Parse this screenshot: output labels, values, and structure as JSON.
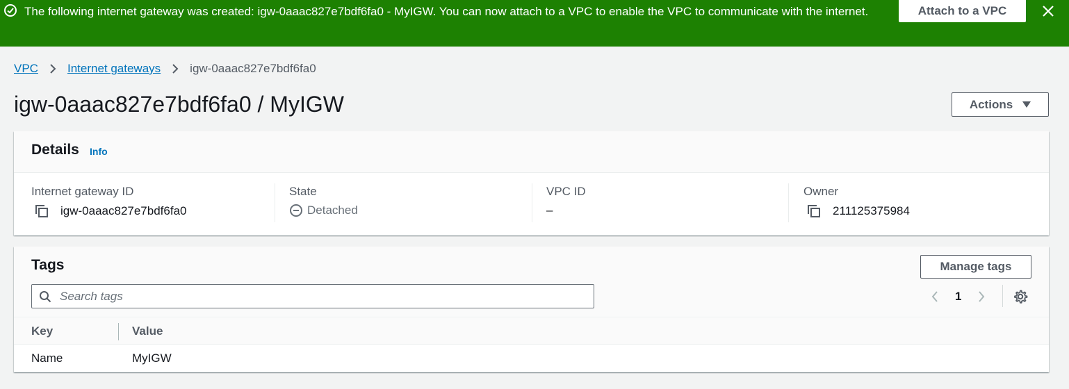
{
  "flash": {
    "message": "The following internet gateway was created: igw-0aaac827e7bdf6fa0 - MyIGW. You can now attach to a VPC to enable the VPC to communicate with the internet.",
    "action_label": "Attach to a VPC",
    "color": "#1d8102"
  },
  "breadcrumb": {
    "items": [
      "VPC",
      "Internet gateways"
    ],
    "current": "igw-0aaac827e7bdf6fa0"
  },
  "page": {
    "title": "igw-0aaac827e7bdf6fa0 / MyIGW",
    "actions_label": "Actions"
  },
  "details": {
    "title": "Details",
    "info_label": "Info",
    "fields": [
      {
        "label": "Internet gateway ID",
        "value": "igw-0aaac827e7bdf6fa0",
        "icon": "copy-icon"
      },
      {
        "label": "State",
        "value": "Detached",
        "icon": "status-stopped-icon"
      },
      {
        "label": "VPC ID",
        "value": "–"
      },
      {
        "label": "Owner",
        "value": "211125375984",
        "icon": "copy-icon"
      }
    ]
  },
  "tags": {
    "title": "Tags",
    "manage_label": "Manage tags",
    "search_placeholder": "Search tags",
    "page_number": "1",
    "columns": [
      "Key",
      "Value"
    ],
    "rows": [
      {
        "key": "Name",
        "value": "MyIGW"
      }
    ]
  },
  "colors": {
    "link": "#0073bb",
    "success": "#1d8102",
    "text": "#16191f",
    "secondary_text": "#545b64"
  }
}
